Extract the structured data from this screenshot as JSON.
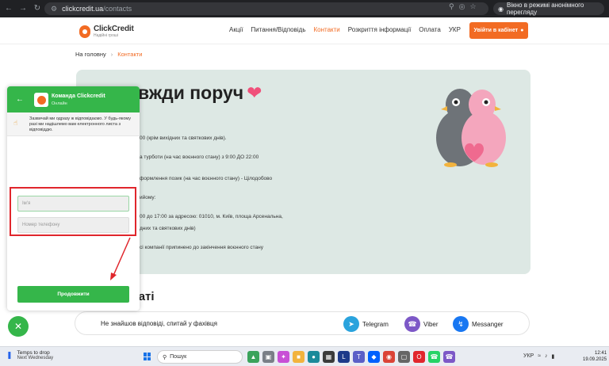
{
  "browser": {
    "url_host": "clickcredit.ua",
    "url_path": "/contacts",
    "incognito_label": "Вікно в режимі анонімного перегляду"
  },
  "header": {
    "logo_name": "ClickCredit",
    "logo_tagline": "Надійні гроші",
    "menu": [
      "Акції",
      "Питання/Відповідь",
      "Контакти",
      "Розкриття інформації",
      "Оплата",
      "УКР"
    ],
    "active_menu": "Контакти",
    "cabinet_button": "Увійти в кабінет"
  },
  "breadcrumb": {
    "home": "На головну",
    "current": "Контакти"
  },
  "contacts": {
    "heading": "вжди поруч",
    "lines": [
      "00 (крім вихідних та святкових днів).",
      "а турботи (на час воєнного стану) з 9:00 ДО 22:00",
      "формлення позик (на час воєнного стану) - Цілодобово",
      "ийому:",
      "00 до 17:00 за адресою: 01010, м. Київ, площа Арсенальна,",
      "дних та святкових днів)",
      "сі компанії припинено до закінчення воєнного стану"
    ]
  },
  "chat_section": {
    "heading": "чаті",
    "ask": "Не знайшов відповіді, спитай у фахівця",
    "messengers": [
      "Telegram",
      "Viber",
      "Messanger"
    ]
  },
  "widget": {
    "title": "Команда Clickcredit",
    "status": "Онлайн",
    "notice": "Зазвичай ми одразу ж відповідаємо. У будь-якому разі ми надішлемо вам електронного листа з відповіддю.",
    "name_placeholder": "Ім'я",
    "phone_placeholder": "Номер телефону",
    "submit": "Продовжити"
  },
  "taskbar": {
    "weather_title": "Temps to drop",
    "weather_sub": "Next Wednesday",
    "search_label": "Пошук",
    "lang": "УКР",
    "time": "12:41",
    "date": "19.09.2025"
  },
  "colors": {
    "accent": "#f26b23",
    "chat_green": "#35b64a",
    "card_bg": "#dde8e4",
    "highlight_red": "#e0262c"
  }
}
